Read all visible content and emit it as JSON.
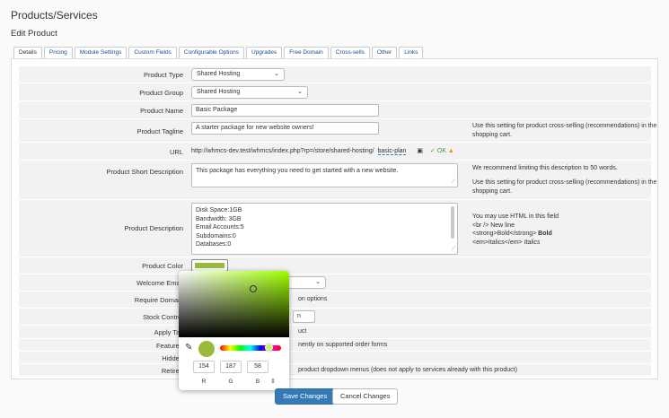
{
  "page": {
    "title": "Products/Services",
    "subtitle": "Edit Product"
  },
  "tabs": [
    "Details",
    "Pricing",
    "Module Settings",
    "Custom Fields",
    "Configurable Options",
    "Upgrades",
    "Free Domain",
    "Cross-sells",
    "Other",
    "Links"
  ],
  "form": {
    "product_type": {
      "label": "Product Type",
      "value": "Shared Hosting"
    },
    "product_group": {
      "label": "Product Group",
      "value": "Shared Hosting"
    },
    "product_name": {
      "label": "Product Name",
      "value": "Basic Package"
    },
    "product_tagline": {
      "label": "Product Tagline",
      "value": "A starter package for new website owners!",
      "help": "Use this setting for product cross-selling (recommendations) in the shopping cart."
    },
    "url": {
      "label": "URL",
      "prefix": "http://whmcs-dev.test/whmcs/index.php?rp=/store/shared-hosting/",
      "slug": "basic-plan",
      "status": "OK"
    },
    "short_description": {
      "label": "Product Short Description",
      "value": "This package has everything you need to get started with a new website.",
      "help1": "We recommend limiting this description to 50 words.",
      "help2": "Use this setting for product cross-selling (recommendations) in the shopping cart."
    },
    "description": {
      "label": "Product Description",
      "lines": [
        "Disk Space:1GB",
        "Bandwidth: 3GB",
        "Email Accounts:5",
        "Subdomains:0",
        "Databases:0"
      ],
      "help_title": "You may use HTML in this field",
      "help_br": "<br /> New line",
      "help_strong": "<strong>Bold</strong>",
      "help_strong_demo": "Bold",
      "help_em": "<em>Italics</em>",
      "help_em_demo": "Italics"
    },
    "product_color": {
      "label": "Product Color",
      "value": "#9abb3a"
    },
    "welcome_email": {
      "label": "Welcome Email"
    },
    "require_domain": {
      "label": "Require Domain",
      "partial": "on options"
    },
    "stock_control": {
      "label": "Stock Control",
      "partial": "n"
    },
    "apply_tax": {
      "label": "Apply Tax",
      "partial": "uct"
    },
    "featured": {
      "label": "Featured",
      "partial": "nently on supported order forms"
    },
    "hidden": {
      "label": "Hidden"
    },
    "retired": {
      "label": "Retired",
      "partial": "product dropdown menus (does not apply to services already with this product)"
    }
  },
  "picker": {
    "r": "154",
    "g": "187",
    "b": "58",
    "r_label": "R",
    "g_label": "G",
    "b_label": "B"
  },
  "buttons": {
    "save": "Save Changes",
    "cancel": "Cancel Changes"
  }
}
